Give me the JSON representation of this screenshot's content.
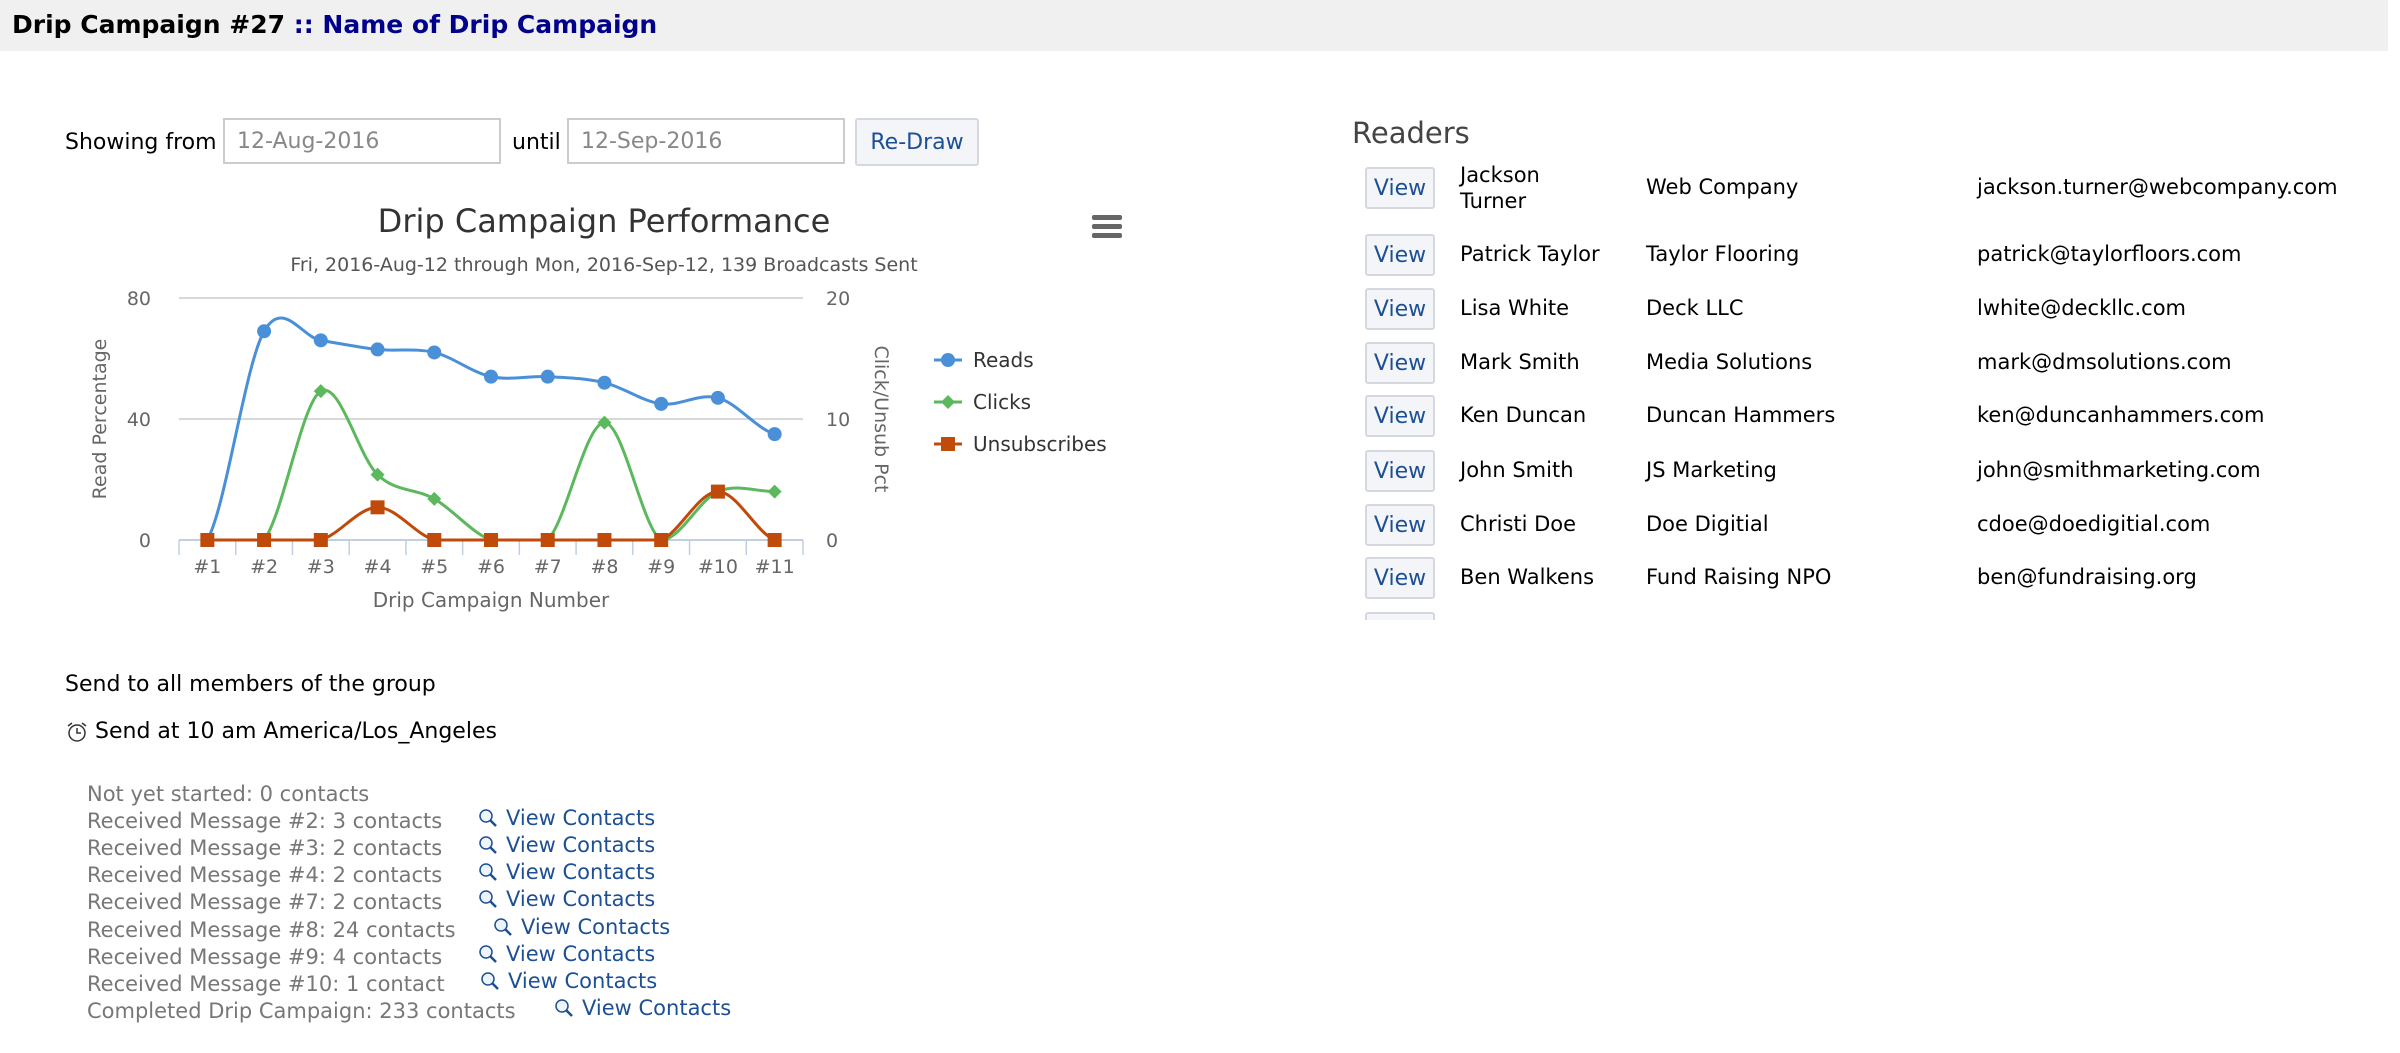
{
  "header": {
    "prefix": "Drip Campaign #27",
    "name": ":: Name of Drip Campaign"
  },
  "filters": {
    "showing_from_label": "Showing from",
    "from_value": "12-Aug-2016",
    "until_label": "until",
    "until_value": "12-Sep-2016",
    "redraw_label": "Re-Draw"
  },
  "chart_data": {
    "type": "line",
    "title": "Drip Campaign Performance",
    "subtitle": "Fri, 2016-Aug-12 through Mon, 2016-Sep-12, 139 Broadcasts Sent",
    "xlabel": "Drip Campaign Number",
    "ylabel": "Read Percentage",
    "y2label": "Click/Unsub Pct",
    "categories": [
      "#1",
      "#2",
      "#3",
      "#4",
      "#5",
      "#6",
      "#7",
      "#8",
      "#9",
      "#10",
      "#11"
    ],
    "ylim": [
      0,
      80
    ],
    "y2lim": [
      0,
      20
    ],
    "yticks": [
      "0",
      "40",
      "80"
    ],
    "y2ticks": [
      "0",
      "10",
      "20"
    ],
    "grid": true,
    "legend_placement": "right",
    "series": [
      {
        "name": "Reads",
        "axis": "left",
        "color": "#4a90d9",
        "marker": "circle",
        "values": [
          0,
          69,
          66,
          63,
          62,
          54,
          54,
          52,
          45,
          47,
          35
        ]
      },
      {
        "name": "Clicks",
        "axis": "right",
        "color": "#5cb85c",
        "marker": "diamond",
        "values": [
          0,
          0,
          12.3,
          5.4,
          3.4,
          0,
          0,
          9.7,
          0,
          4,
          4
        ]
      },
      {
        "name": "Unsubscribes",
        "axis": "right",
        "color": "#c04a0a",
        "marker": "square",
        "values": [
          0,
          0,
          0,
          2.7,
          0,
          0,
          0,
          0,
          0,
          4,
          0
        ]
      }
    ]
  },
  "readers": {
    "title": "Readers",
    "view_label": "View",
    "rows": [
      {
        "name": "Jackson Turner",
        "company": "Web Company",
        "email": "jackson.turner@webcompany.com"
      },
      {
        "name": "Patrick Taylor",
        "company": "Taylor Flooring",
        "email": "patrick@taylorfloors.com"
      },
      {
        "name": "Lisa White",
        "company": "Deck LLC",
        "email": "lwhite@deckllc.com"
      },
      {
        "name": "Mark Smith",
        "company": "Media Solutions",
        "email": "mark@dmsolutions.com"
      },
      {
        "name": "Ken Duncan",
        "company": "Duncan Hammers",
        "email": "ken@duncanhammers.com"
      },
      {
        "name": "John Smith",
        "company": "JS Marketing",
        "email": "john@smithmarketing.com"
      },
      {
        "name": "Christi Doe",
        "company": "Doe Digitial",
        "email": "cdoe@doedigitial.com"
      },
      {
        "name": "Ben Walkens",
        "company": "Fund Raising NPO",
        "email": "ben@fundraising.org"
      }
    ]
  },
  "send": {
    "group_text": "Send to all members of the group",
    "schedule_text": "Send at 10 am America/Los_Angeles"
  },
  "progress": {
    "link_label": "View Contacts",
    "rows": [
      {
        "text": "Not yet started: 0 contacts",
        "link": false
      },
      {
        "text": "Received Message #2: 3 contacts",
        "link": true
      },
      {
        "text": "Received Message #3: 2 contacts",
        "link": true
      },
      {
        "text": "Received Message #4: 2 contacts",
        "link": true
      },
      {
        "text": "Received Message #7: 2 contacts",
        "link": true
      },
      {
        "text": "Received Message #8: 24 contacts",
        "link": true
      },
      {
        "text": "Received Message #9: 4 contacts",
        "link": true
      },
      {
        "text": "Received Message #10: 1 contact",
        "link": true
      },
      {
        "text": "Completed Drip Campaign: 233 contacts",
        "link": true
      }
    ]
  }
}
